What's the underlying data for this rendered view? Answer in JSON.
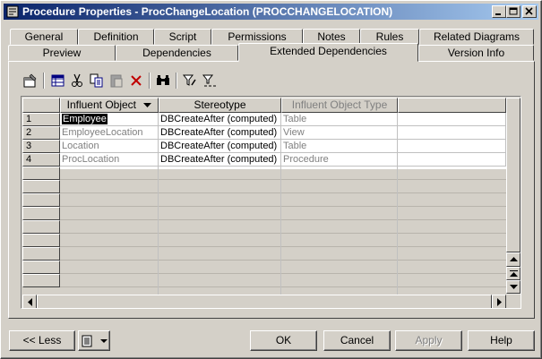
{
  "window": {
    "title": "Procedure Properties - ProcChangeLocation (PROCCHANGELOCATION)"
  },
  "tabs": {
    "row1": [
      {
        "label": "General"
      },
      {
        "label": "Definition"
      },
      {
        "label": "Script"
      },
      {
        "label": "Permissions"
      },
      {
        "label": "Notes"
      },
      {
        "label": "Rules"
      },
      {
        "label": "Related Diagrams"
      }
    ],
    "row2": [
      {
        "label": "Preview"
      },
      {
        "label": "Dependencies"
      },
      {
        "label": "Extended Dependencies"
      },
      {
        "label": "Version Info"
      }
    ],
    "active": "Extended Dependencies"
  },
  "toolbar": {
    "icons": [
      "properties-icon",
      "add-rows-icon",
      "cut-icon",
      "copy-icon",
      "paste-icon",
      "delete-icon",
      "find-icon",
      "filter-icon",
      "filter-clear-icon"
    ]
  },
  "grid": {
    "columns": [
      "Influent Object",
      "Stereotype",
      "Influent Object Type"
    ],
    "rows": [
      {
        "num": "1",
        "object": "Employee",
        "stereotype": "DBCreateAfter (computed)",
        "type": "Table"
      },
      {
        "num": "2",
        "object": "EmployeeLocation",
        "stereotype": "DBCreateAfter (computed)",
        "type": "View"
      },
      {
        "num": "3",
        "object": "Location",
        "stereotype": "DBCreateAfter (computed)",
        "type": "Table"
      },
      {
        "num": "4",
        "object": "ProcLocation",
        "stereotype": "DBCreateAfter (computed)",
        "type": "Procedure"
      }
    ]
  },
  "buttons": {
    "less": "<< Less",
    "ok": "OK",
    "cancel": "Cancel",
    "apply": "Apply",
    "help": "Help"
  }
}
